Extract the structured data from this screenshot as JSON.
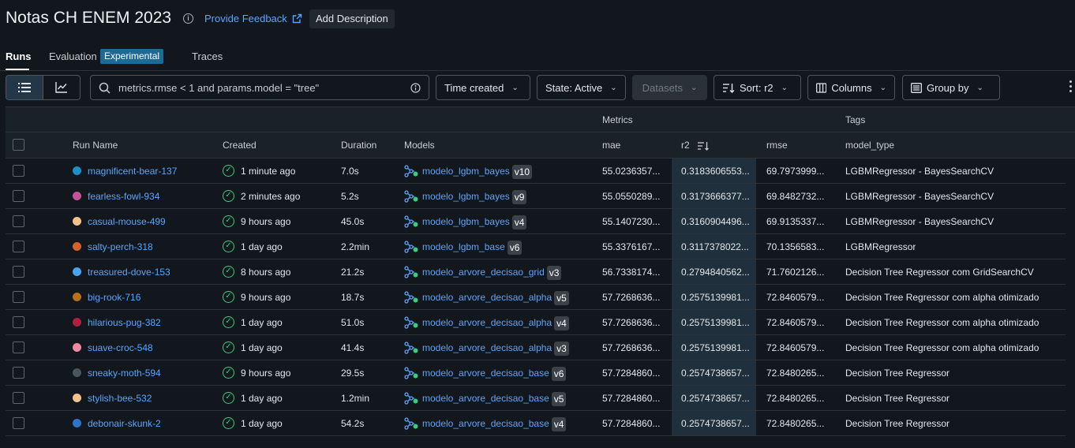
{
  "header": {
    "title": "Notas CH ENEM 2023",
    "feedback_label": "Provide Feedback",
    "add_description_label": "Add Description"
  },
  "tabs": {
    "runs": "Runs",
    "evaluation": "Evaluation",
    "experimental_badge": "Experimental",
    "traces": "Traces"
  },
  "toolbar": {
    "search_value": "metrics.rmse < 1 and params.model = \"tree\"",
    "time_created": "Time created",
    "state": "State: Active",
    "datasets": "Datasets",
    "sort": "Sort: r2",
    "columns": "Columns",
    "group_by": "Group by"
  },
  "table": {
    "groups": {
      "metrics": "Metrics",
      "tags": "Tags"
    },
    "columns": {
      "run_name": "Run Name",
      "created": "Created",
      "duration": "Duration",
      "models": "Models",
      "mae": "mae",
      "r2": "r2",
      "rmse": "rmse",
      "model_type": "model_type"
    },
    "rows": [
      {
        "run_name": "magnificent-bear-137",
        "color": "#1f8fc8",
        "created": "1 minute ago",
        "duration": "7.0s",
        "model": "modelo_lgbm_bayes",
        "version": "v10",
        "mae": "55.0236357...",
        "r2": "0.3183606553...",
        "rmse": "69.7973999...",
        "model_type": "LGBMRegressor - BayesSearchCV"
      },
      {
        "run_name": "fearless-fowl-934",
        "color": "#c2559a",
        "created": "2 minutes ago",
        "duration": "5.2s",
        "model": "modelo_lgbm_bayes",
        "version": "v9",
        "mae": "55.0550289...",
        "r2": "0.3173666377...",
        "rmse": "69.8482732...",
        "model_type": "LGBMRegressor - BayesSearchCV"
      },
      {
        "run_name": "casual-mouse-499",
        "color": "#f2c28a",
        "created": "9 hours ago",
        "duration": "45.0s",
        "model": "modelo_lgbm_bayes",
        "version": "v4",
        "mae": "55.1407230...",
        "r2": "0.3160904496...",
        "rmse": "69.9135337...",
        "model_type": "LGBMRegressor - BayesSearchCV"
      },
      {
        "run_name": "salty-perch-318",
        "color": "#d6622b",
        "created": "1 day ago",
        "duration": "2.2min",
        "model": "modelo_lgbm_base",
        "version": "v6",
        "mae": "55.3376167...",
        "r2": "0.3117378022...",
        "rmse": "70.1356583...",
        "model_type": "LGBMRegressor"
      },
      {
        "run_name": "treasured-dove-153",
        "color": "#4aa3f0",
        "created": "8 hours ago",
        "duration": "21.2s",
        "model": "modelo_arvore_decisao_grid",
        "version": "v3",
        "mae": "56.7338174...",
        "r2": "0.2794840562...",
        "rmse": "71.7602126...",
        "model_type": "Decision Tree Regressor com GridSearchCV"
      },
      {
        "run_name": "big-rook-716",
        "color": "#b8701c",
        "created": "9 hours ago",
        "duration": "18.7s",
        "model": "modelo_arvore_decisao_alpha",
        "version": "v5",
        "mae": "57.7268636...",
        "r2": "0.2575139981...",
        "rmse": "72.8460579...",
        "model_type": "Decision Tree Regressor com alpha otimizado"
      },
      {
        "run_name": "hilarious-pug-382",
        "color": "#b0203c",
        "created": "1 day ago",
        "duration": "51.0s",
        "model": "modelo_arvore_decisao_alpha",
        "version": "v4",
        "mae": "57.7268636...",
        "r2": "0.2575139981...",
        "rmse": "72.8460579...",
        "model_type": "Decision Tree Regressor com alpha otimizado"
      },
      {
        "run_name": "suave-croc-548",
        "color": "#f08aa0",
        "created": "1 day ago",
        "duration": "41.4s",
        "model": "modelo_arvore_decisao_alpha",
        "version": "v3",
        "mae": "57.7268636...",
        "r2": "0.2575139981...",
        "rmse": "72.8460579...",
        "model_type": "Decision Tree Regressor com alpha otimizado"
      },
      {
        "run_name": "sneaky-moth-594",
        "color": "#4a555d",
        "created": "9 hours ago",
        "duration": "29.5s",
        "model": "modelo_arvore_decisao_base",
        "version": "v6",
        "mae": "57.7284860...",
        "r2": "0.2574738657...",
        "rmse": "72.8480265...",
        "model_type": "Decision Tree Regressor"
      },
      {
        "run_name": "stylish-bee-532",
        "color": "#f2c28a",
        "created": "1 day ago",
        "duration": "1.2min",
        "model": "modelo_arvore_decisao_base",
        "version": "v5",
        "mae": "57.7284860...",
        "r2": "0.2574738657...",
        "rmse": "72.8480265...",
        "model_type": "Decision Tree Regressor"
      },
      {
        "run_name": "debonair-skunk-2",
        "color": "#2d74c9",
        "created": "1 day ago",
        "duration": "54.2s",
        "model": "modelo_arvore_decisao_base",
        "version": "v4",
        "mae": "57.7284860...",
        "r2": "0.2574738657...",
        "rmse": "72.8480265...",
        "model_type": "Decision Tree Regressor"
      }
    ]
  }
}
